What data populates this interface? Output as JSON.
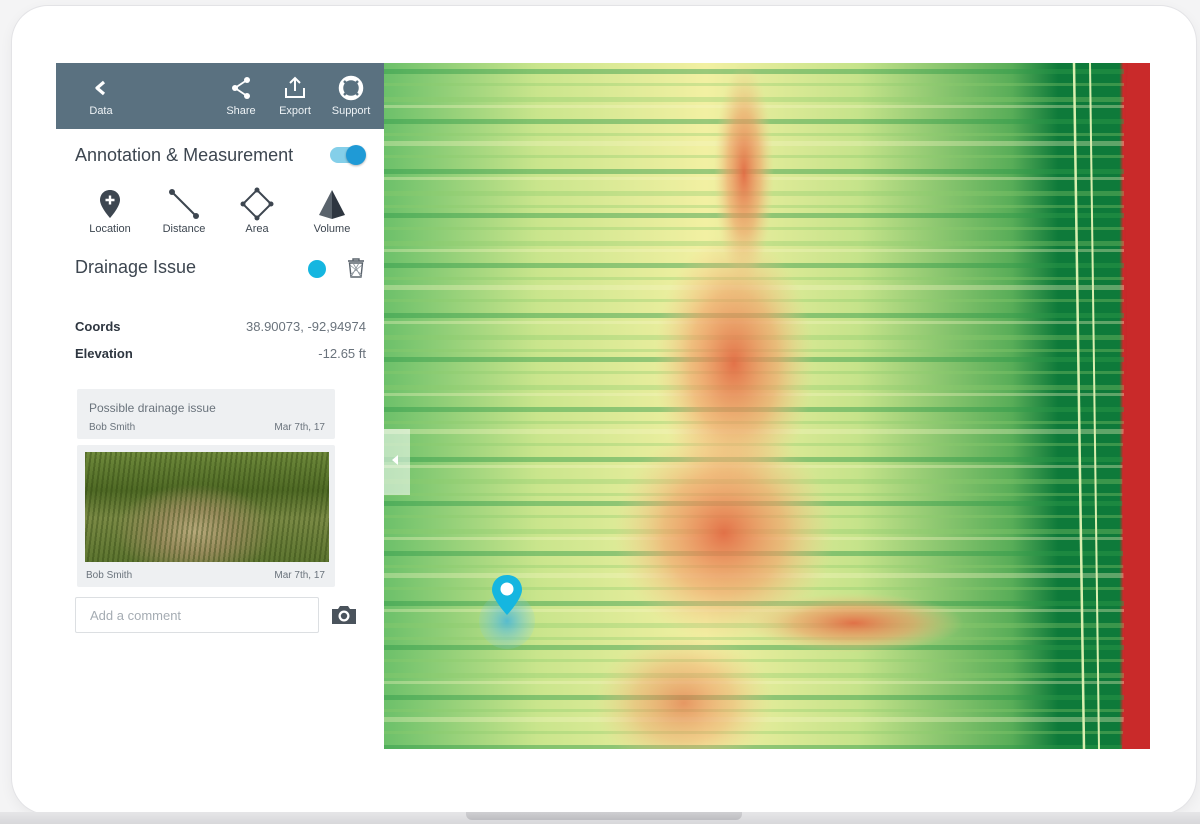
{
  "colors": {
    "topbar": "#5a7180",
    "accent": "#1f9ad6",
    "issue_marker": "#15b6e0",
    "map_red": "#c92a2a",
    "map_orange": "#e98b58",
    "map_yellow": "#f1f3a0",
    "map_green": "#0e7a3a"
  },
  "topbar": {
    "back": {
      "label": "Data",
      "icon": "chevron-left-icon"
    },
    "actions": [
      {
        "label": "Share",
        "icon": "share-icon"
      },
      {
        "label": "Export",
        "icon": "export-icon"
      },
      {
        "label": "Support",
        "icon": "lifebuoy-icon"
      }
    ]
  },
  "annotation": {
    "title": "Annotation & Measurement",
    "enabled": true,
    "tools": [
      {
        "label": "Location",
        "icon": "location-pin-add-icon"
      },
      {
        "label": "Distance",
        "icon": "distance-line-icon"
      },
      {
        "label": "Area",
        "icon": "area-polygon-icon"
      },
      {
        "label": "Volume",
        "icon": "volume-pyramid-icon"
      }
    ]
  },
  "issue": {
    "title": "Drainage Issue",
    "fields": [
      {
        "label": "Coords",
        "value": "38.90073, -92,94974"
      },
      {
        "label": "Elevation",
        "value": "-12.65 ft"
      }
    ]
  },
  "comments": [
    {
      "text": "Possible drainage issue",
      "author": "Bob Smith",
      "date": "Mar 7th, 17"
    }
  ],
  "photo_comment": {
    "author": "Bob Smith",
    "date": "Mar 7th, 17"
  },
  "comment_input": {
    "placeholder": "Add a comment",
    "value": ""
  }
}
